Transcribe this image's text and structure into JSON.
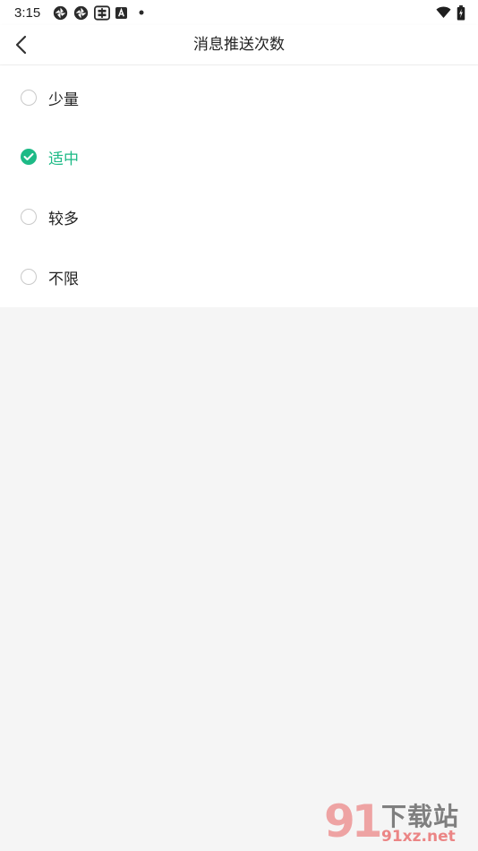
{
  "status_bar": {
    "time": "3:15",
    "left_icons": [
      "aperture-icon",
      "aperture-icon",
      "keyboard-icon",
      "a-badge-icon",
      "dot-icon"
    ],
    "right_icons": [
      "wifi-icon",
      "battery-icon"
    ]
  },
  "header": {
    "title": "消息推送次数",
    "back_icon": "chevron-left-icon"
  },
  "options": [
    {
      "label": "少量",
      "checked": false
    },
    {
      "label": "适中",
      "checked": true
    },
    {
      "label": "较多",
      "checked": false
    },
    {
      "label": "不限",
      "checked": false
    }
  ],
  "colors": {
    "accent": "#1dba86",
    "text": "#222222",
    "background": "#f5f5f5",
    "surface": "#ffffff",
    "radio_border": "#c9c9c9"
  },
  "watermark": {
    "logo": "91",
    "title": "下载站",
    "url": "91xz.net"
  }
}
